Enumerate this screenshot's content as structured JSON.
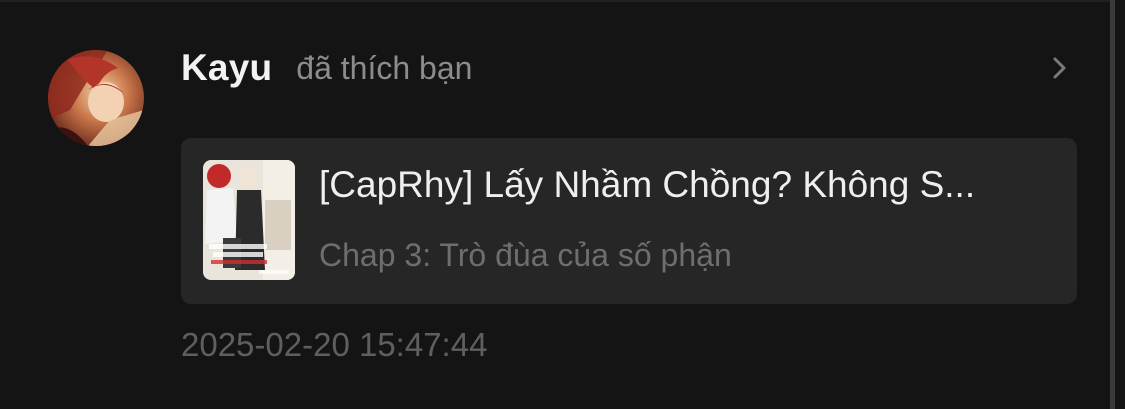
{
  "notification": {
    "user_name": "Kayu",
    "action_text": "đã thích bạn",
    "avatar_icon": "anime-character-avatar",
    "chevron_icon": "chevron-right-icon",
    "card": {
      "thumbnail_icon": "comic-cover-thumbnail",
      "title": "[CapRhy] Lấy Nhầm Chồng? Không S...",
      "subtitle": "Chap 3: Trò đùa của số phận"
    },
    "timestamp": "2025-02-20 15:47:44"
  },
  "colors": {
    "background": "#141414",
    "card_background": "#262626",
    "primary_text": "#f2f2f2",
    "secondary_text": "#8c8c8c",
    "muted_text": "#5f5f5f"
  }
}
